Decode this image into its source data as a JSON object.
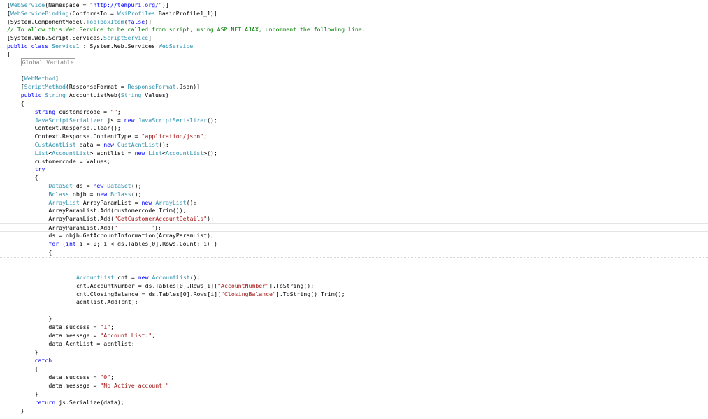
{
  "code_lines": [
    {
      "t": 2,
      "indent": 0,
      "tokens": [
        {
          "k": "p",
          "s": "["
        },
        {
          "k": "ty",
          "s": "WebService"
        },
        {
          "k": "p",
          "s": "(Namespace = "
        },
        {
          "k": "st",
          "s": "\""
        },
        {
          "k": "lk",
          "s": "http://tempuri.org/"
        },
        {
          "k": "st",
          "s": "\""
        },
        {
          "k": "p",
          "s": ")]"
        }
      ]
    },
    {
      "t": 14,
      "indent": 0,
      "tokens": [
        {
          "k": "p",
          "s": "["
        },
        {
          "k": "ty",
          "s": "WebServiceBinding"
        },
        {
          "k": "p",
          "s": "(ConformsTo = "
        },
        {
          "k": "ty",
          "s": "WsiProfiles"
        },
        {
          "k": "p",
          "s": ".BasicProfile1_1)]"
        }
      ]
    },
    {
      "t": 26,
      "indent": 0,
      "tokens": [
        {
          "k": "p",
          "s": "[System.ComponentModel."
        },
        {
          "k": "ty",
          "s": "ToolboxItem"
        },
        {
          "k": "p",
          "s": "("
        },
        {
          "k": "kw",
          "s": "false"
        },
        {
          "k": "p",
          "s": ")]"
        }
      ]
    },
    {
      "t": 37,
      "indent": 0,
      "tokens": [
        {
          "k": "cm",
          "s": "// To allow this Web Service to be called from script, using ASP.NET AJAX, uncomment the following line."
        }
      ]
    },
    {
      "t": 49,
      "indent": 0,
      "tokens": [
        {
          "k": "p",
          "s": "[System.Web.Script.Services."
        },
        {
          "k": "ty",
          "s": "ScriptService"
        },
        {
          "k": "p",
          "s": "]"
        }
      ]
    },
    {
      "t": 61,
      "indent": 0,
      "tokens": [
        {
          "k": "kw",
          "s": "public class "
        },
        {
          "k": "ty",
          "s": "Service1"
        },
        {
          "k": "p",
          "s": " : System.Web.Services."
        },
        {
          "k": "ty",
          "s": "WebService"
        }
      ]
    },
    {
      "t": 72,
      "indent": 0,
      "tokens": [
        {
          "k": "p",
          "s": "{"
        }
      ]
    },
    {
      "t": 84,
      "indent": 4,
      "tokens": [
        {
          "k": "region",
          "s": "Global Variable"
        }
      ]
    },
    {
      "t": 107,
      "indent": 4,
      "tokens": [
        {
          "k": "p",
          "s": "["
        },
        {
          "k": "ty",
          "s": "WebMethod"
        },
        {
          "k": "p",
          "s": "]"
        }
      ]
    },
    {
      "t": 119,
      "indent": 4,
      "tokens": [
        {
          "k": "p",
          "s": "["
        },
        {
          "k": "ty",
          "s": "ScriptMethod"
        },
        {
          "k": "p",
          "s": "(ResponseFormat = "
        },
        {
          "k": "ty",
          "s": "ResponseFormat"
        },
        {
          "k": "p",
          "s": ".Json)]"
        }
      ]
    },
    {
      "t": 131,
      "indent": 4,
      "tokens": [
        {
          "k": "kw",
          "s": "public "
        },
        {
          "k": "ty",
          "s": "String"
        },
        {
          "k": "p",
          "s": " AccountListWeb("
        },
        {
          "k": "ty",
          "s": "String"
        },
        {
          "k": "p",
          "s": " Values)"
        }
      ]
    },
    {
      "t": 143,
      "indent": 4,
      "tokens": [
        {
          "k": "p",
          "s": "{"
        }
      ]
    },
    {
      "t": 155,
      "indent": 8,
      "tokens": [
        {
          "k": "kw",
          "s": "string"
        },
        {
          "k": "p",
          "s": " customercode = "
        },
        {
          "k": "st",
          "s": "\"\""
        },
        {
          "k": "p",
          "s": ";"
        }
      ]
    },
    {
      "t": 167,
      "indent": 8,
      "tokens": [
        {
          "k": "ty",
          "s": "JavaScriptSerializer"
        },
        {
          "k": "p",
          "s": " js = "
        },
        {
          "k": "kw",
          "s": "new "
        },
        {
          "k": "ty",
          "s": "JavaScriptSerializer"
        },
        {
          "k": "p",
          "s": "();"
        }
      ]
    },
    {
      "t": 178,
      "indent": 8,
      "tokens": [
        {
          "k": "p",
          "s": "Context.Response.Clear();"
        }
      ]
    },
    {
      "t": 190,
      "indent": 8,
      "tokens": [
        {
          "k": "p",
          "s": "Context.Response.ContentType = "
        },
        {
          "k": "st",
          "s": "\"application/json\""
        },
        {
          "k": "p",
          "s": ";"
        }
      ]
    },
    {
      "t": 202,
      "indent": 8,
      "tokens": [
        {
          "k": "ty",
          "s": "CustAcntList"
        },
        {
          "k": "p",
          "s": " data = "
        },
        {
          "k": "kw",
          "s": "new "
        },
        {
          "k": "ty",
          "s": "CustAcntList"
        },
        {
          "k": "p",
          "s": "();"
        }
      ]
    },
    {
      "t": 214,
      "indent": 8,
      "tokens": [
        {
          "k": "ty",
          "s": "List"
        },
        {
          "k": "p",
          "s": "<"
        },
        {
          "k": "ty",
          "s": "AccountList"
        },
        {
          "k": "p",
          "s": "> acntlist = "
        },
        {
          "k": "kw",
          "s": "new "
        },
        {
          "k": "ty",
          "s": "List"
        },
        {
          "k": "p",
          "s": "<"
        },
        {
          "k": "ty",
          "s": "AccountList"
        },
        {
          "k": "p",
          "s": ">();"
        }
      ]
    },
    {
      "t": 226,
      "indent": 8,
      "tokens": [
        {
          "k": "p",
          "s": "customercode = Values;"
        }
      ]
    },
    {
      "t": 237,
      "indent": 8,
      "tokens": [
        {
          "k": "kw",
          "s": "try"
        }
      ]
    },
    {
      "t": 249,
      "indent": 8,
      "tokens": [
        {
          "k": "p",
          "s": "{"
        }
      ]
    },
    {
      "t": 261,
      "indent": 12,
      "tokens": [
        {
          "k": "ty",
          "s": "DataSet"
        },
        {
          "k": "p",
          "s": " ds = "
        },
        {
          "k": "kw",
          "s": "new "
        },
        {
          "k": "ty",
          "s": "DataSet"
        },
        {
          "k": "p",
          "s": "();"
        }
      ]
    },
    {
      "t": 273,
      "indent": 12,
      "tokens": [
        {
          "k": "ty",
          "s": "Bclass"
        },
        {
          "k": "p",
          "s": " objb = "
        },
        {
          "k": "kw",
          "s": "new "
        },
        {
          "k": "ty",
          "s": "Bclass"
        },
        {
          "k": "p",
          "s": "();"
        }
      ]
    },
    {
      "t": 285,
      "indent": 12,
      "tokens": [
        {
          "k": "ty",
          "s": "ArrayList"
        },
        {
          "k": "p",
          "s": " ArrayParamList = "
        },
        {
          "k": "kw",
          "s": "new "
        },
        {
          "k": "ty",
          "s": "ArrayList"
        },
        {
          "k": "p",
          "s": "();"
        }
      ]
    },
    {
      "t": 296,
      "indent": 12,
      "tokens": [
        {
          "k": "p",
          "s": "ArrayParamList.Add(customercode.Trim());"
        }
      ]
    },
    {
      "t": 308,
      "indent": 12,
      "tokens": [
        {
          "k": "p",
          "s": "ArrayParamList.Add("
        },
        {
          "k": "st",
          "s": "\"GetCustomerAccountDetails\""
        },
        {
          "k": "p",
          "s": ");"
        }
      ]
    },
    {
      "t": 320,
      "indent": 12,
      "current": true,
      "tokens": [
        {
          "k": "p",
          "s": "ArrayParamList.Add("
        },
        {
          "k": "st",
          "s": "\""
        },
        {
          "k": "redact",
          "s": ""
        },
        {
          "k": "st",
          "s": "\""
        },
        {
          "k": "p",
          "s": ");"
        }
      ]
    },
    {
      "t": 332,
      "indent": 12,
      "tokens": [
        {
          "k": "p",
          "s": "ds = objb.GetAccountInformation(ArrayParamList);"
        }
      ]
    },
    {
      "t": 344,
      "indent": 12,
      "tokens": [
        {
          "k": "kw",
          "s": "for"
        },
        {
          "k": "p",
          "s": " ("
        },
        {
          "k": "kw",
          "s": "int"
        },
        {
          "k": "p",
          "s": " i = 0; i < ds.Tables[0].Rows.Count; i++)"
        }
      ]
    },
    {
      "t": 356,
      "indent": 12,
      "dotted": true,
      "tokens": [
        {
          "k": "p",
          "s": "{"
        }
      ]
    },
    {
      "t": 392,
      "indent": 20,
      "tokens": [
        {
          "k": "ty",
          "s": "AccountList"
        },
        {
          "k": "p",
          "s": " cnt = "
        },
        {
          "k": "kw",
          "s": "new "
        },
        {
          "k": "ty",
          "s": "AccountList"
        },
        {
          "k": "p",
          "s": "();"
        }
      ]
    },
    {
      "t": 404,
      "indent": 20,
      "tokens": [
        {
          "k": "p",
          "s": "cnt.AccountNumber = ds.Tables[0].Rows[i]["
        },
        {
          "k": "st",
          "s": "\"AccountNumber\""
        },
        {
          "k": "p",
          "s": "].ToString();"
        }
      ]
    },
    {
      "t": 416,
      "indent": 20,
      "tokens": [
        {
          "k": "p",
          "s": "cnt.ClosingBalance = ds.Tables[0].Rows[i]["
        },
        {
          "k": "st",
          "s": "\"ClosingBalance\""
        },
        {
          "k": "p",
          "s": "].ToString().Trim();"
        }
      ]
    },
    {
      "t": 427,
      "indent": 20,
      "tokens": [
        {
          "k": "p",
          "s": "acntlist.Add(cnt);"
        }
      ]
    },
    {
      "t": 451,
      "indent": 12,
      "tokens": [
        {
          "k": "p",
          "s": "}"
        }
      ]
    },
    {
      "t": 463,
      "indent": 12,
      "tokens": [
        {
          "k": "p",
          "s": "data.success = "
        },
        {
          "k": "st",
          "s": "\"1\""
        },
        {
          "k": "p",
          "s": ";"
        }
      ]
    },
    {
      "t": 475,
      "indent": 12,
      "tokens": [
        {
          "k": "p",
          "s": "data.message = "
        },
        {
          "k": "st",
          "s": "\"Account List.\""
        },
        {
          "k": "p",
          "s": ";"
        }
      ]
    },
    {
      "t": 487,
      "indent": 12,
      "tokens": [
        {
          "k": "p",
          "s": "data.AcntList = acntlist;"
        }
      ]
    },
    {
      "t": 499,
      "indent": 8,
      "tokens": [
        {
          "k": "p",
          "s": "}"
        }
      ]
    },
    {
      "t": 511,
      "indent": 8,
      "tokens": [
        {
          "k": "kw",
          "s": "catch"
        }
      ]
    },
    {
      "t": 523,
      "indent": 8,
      "tokens": [
        {
          "k": "p",
          "s": "{"
        }
      ]
    },
    {
      "t": 535,
      "indent": 12,
      "tokens": [
        {
          "k": "p",
          "s": "data.success = "
        },
        {
          "k": "st",
          "s": "\"0\""
        },
        {
          "k": "p",
          "s": ";"
        }
      ]
    },
    {
      "t": 547,
      "indent": 12,
      "tokens": [
        {
          "k": "p",
          "s": "data.message = "
        },
        {
          "k": "st",
          "s": "\"No Active account.\""
        },
        {
          "k": "p",
          "s": ";"
        }
      ]
    },
    {
      "t": 559,
      "indent": 8,
      "tokens": [
        {
          "k": "p",
          "s": "}"
        }
      ]
    },
    {
      "t": 571,
      "indent": 8,
      "tokens": [
        {
          "k": "kw",
          "s": "return"
        },
        {
          "k": "p",
          "s": " js.Serialize(data);"
        }
      ]
    },
    {
      "t": 583,
      "indent": 4,
      "tokens": [
        {
          "k": "p",
          "s": "}"
        }
      ]
    }
  ],
  "colors": {
    "keyword": "#0000ff",
    "type": "#2b91af",
    "string": "#a31515",
    "comment": "#008000",
    "collapsed_region_border": "#a0a0a0"
  }
}
